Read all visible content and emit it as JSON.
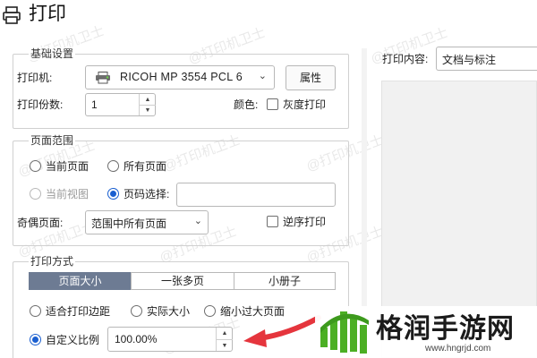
{
  "title": "打印",
  "basic": {
    "legend": "基础设置",
    "printer_label": "打印机:",
    "printer_value": "RICOH MP 3554 PCL 6",
    "properties_button": "属性",
    "copies_label": "打印份数:",
    "copies_value": "1",
    "color_label": "颜色:",
    "grayscale_label": "灰度打印"
  },
  "page_range": {
    "legend": "页面范围",
    "current_page": "当前页面",
    "all_pages": "所有页面",
    "current_view": "当前视图",
    "page_select": "页码选择:",
    "page_select_value": "",
    "odd_even_label": "奇偶页面:",
    "odd_even_value": "范围中所有页面",
    "reverse_label": "逆序打印"
  },
  "print_mode": {
    "legend": "打印方式",
    "tabs": [
      "页面大小",
      "一张多页",
      "小册子"
    ],
    "fit_margins": "适合打印边距",
    "actual_size": "实际大小",
    "shrink_oversize": "缩小过大页面",
    "custom_scale": "自定义比例",
    "custom_scale_value": "100.00%"
  },
  "right_panel": {
    "content_label": "打印内容:",
    "content_value": "文档与标注"
  },
  "watermark_text": "@打印机卫士",
  "brand": {
    "name": "格润手游网",
    "url": "www.hngrjd.com"
  },
  "colors": {
    "accent": "#1a5fd0",
    "active_tab": "#6d7b93",
    "arrow": "#e5353d",
    "logo_green": "#4caf24"
  }
}
